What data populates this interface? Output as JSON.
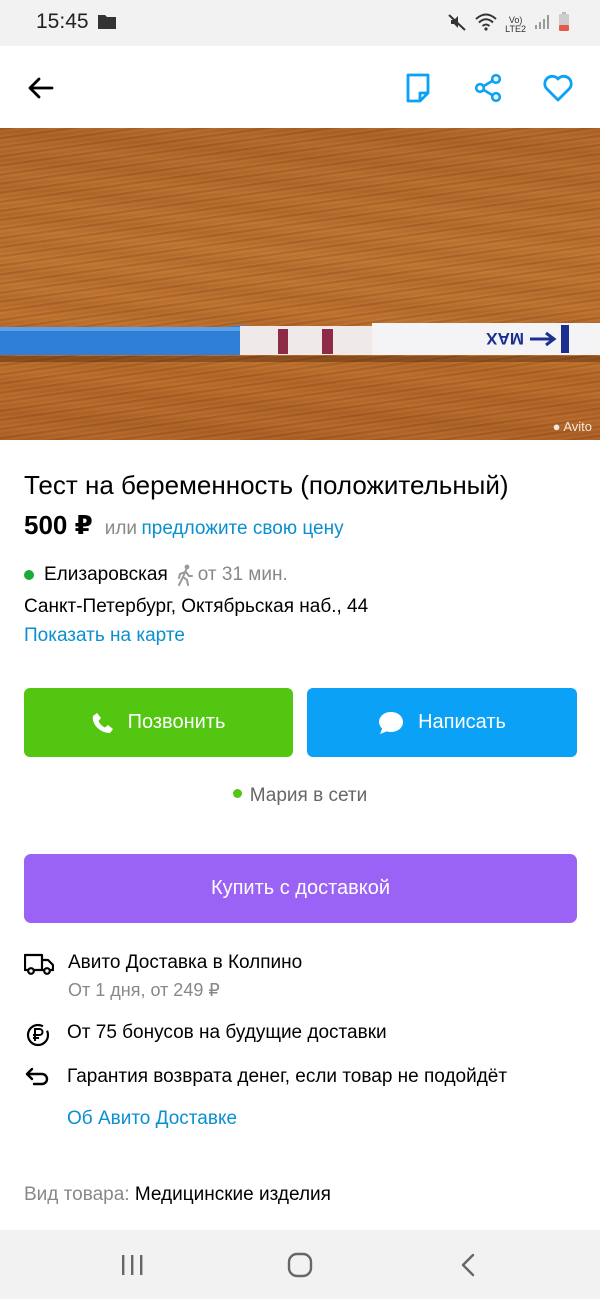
{
  "status_bar": {
    "time": "15:45",
    "network": "LTE2",
    "volte": "Vo)"
  },
  "listing": {
    "title": "Тест на беременность (положительный)",
    "price": "500 ₽",
    "price_or": "или",
    "offer_link": "предложите свою цену",
    "metro_station": "Елизаровская",
    "walk_time": "от 31 мин.",
    "address": "Санкт-Петербург, Октябрьская наб., 44",
    "map_link": "Показать на карте",
    "photo_watermark": "Avito",
    "strip_text": "MAX"
  },
  "actions": {
    "call_label": "Позвонить",
    "write_label": "Написать",
    "buy_label": "Купить с доставкой"
  },
  "seller": {
    "online_text": "Мария в сети"
  },
  "delivery": {
    "title": "Авито Доставка в Колпино",
    "subtitle": "От 1 дня, от 249 ₽",
    "bonus": "От 75 бонусов на будущие доставки",
    "guarantee": "Гарантия возврата денег, если товар не подойдёт",
    "about_link": "Об Авито Доставке"
  },
  "details": {
    "category_key": "Вид товара:",
    "category_value": "Медицинские изделия"
  },
  "colors": {
    "call": "#53c611",
    "write": "#0aa1f6",
    "buy": "#9a63f5",
    "link": "#0a8fd0",
    "metro_dot": "#1aaa37"
  }
}
